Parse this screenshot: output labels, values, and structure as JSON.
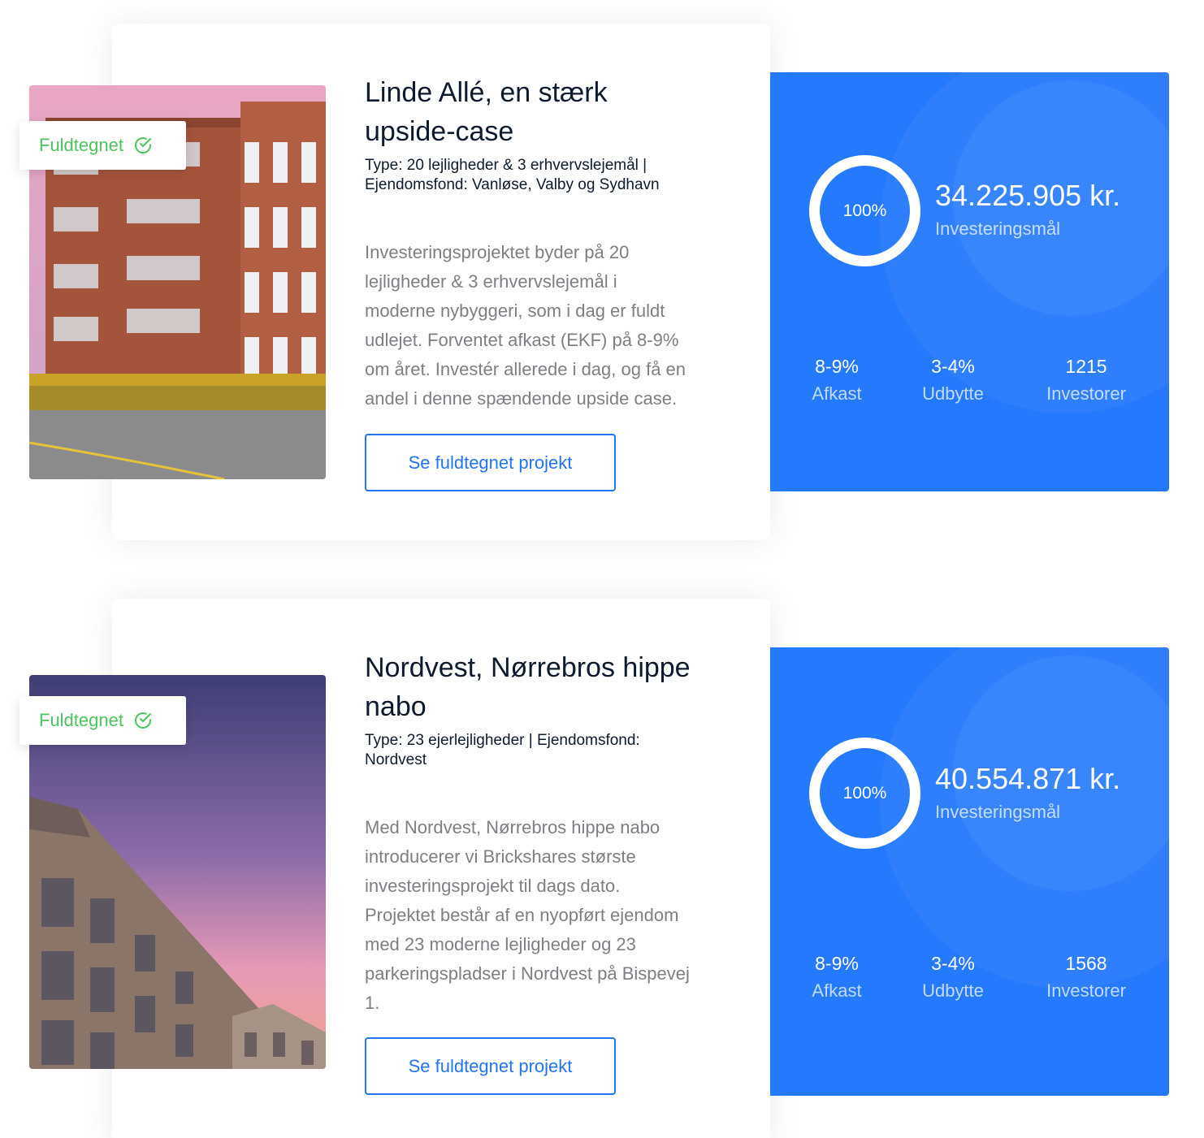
{
  "projects": [
    {
      "badge": "Fuldtegnet",
      "title_lines": [
        "Linde Allé, en stærk",
        "upside-case"
      ],
      "type_lines": [
        "Type: 20 lejligheder & 3 erhvervslejemål |",
        "Ejendomsfond: Vanløse, Valby og Sydhavn"
      ],
      "description_lines": [
        "Investeringsprojektet byder på 20",
        "lejligheder & 3 erhvervslejemål i",
        "moderne nybyggeri, som i dag er fuldt",
        "udlejet. Forventet afkast (EKF) på 8-9%",
        "om året. Investér allerede i dag, og få en",
        "andel i denne spændende upside case."
      ],
      "button": "Se fuldtegnet projekt",
      "progress": "100%",
      "progress_fraction": 1.0,
      "amount": "34.225.905 kr.",
      "amount_label": "Investeringsmål",
      "stats": [
        {
          "value": "8-9%",
          "label": "Afkast"
        },
        {
          "value": "3-4%",
          "label": "Udbytte"
        },
        {
          "value": "1215",
          "label": "Investorer"
        }
      ]
    },
    {
      "badge": "Fuldtegnet",
      "title_lines": [
        "Nordvest, Nørrebros hippe",
        "nabo"
      ],
      "type_lines": [
        "Type: 23 ejerlejligheder | Ejendomsfond:",
        "Nordvest"
      ],
      "description_lines": [
        "Med Nordvest, Nørrebros hippe nabo",
        "introducerer vi Brickshares største",
        "investeringsprojekt til dags dato.",
        "Projektet består af en nyopført ejendom",
        "med 23 moderne lejligheder og 23",
        "parkeringspladser i Nordvest på Bispevej",
        "1."
      ],
      "button": "Se fuldtegnet projekt",
      "progress": "100%",
      "progress_fraction": 1.0,
      "amount": "40.554.871 kr.",
      "amount_label": "Investeringsmål",
      "stats": [
        {
          "value": "8-9%",
          "label": "Afkast"
        },
        {
          "value": "3-4%",
          "label": "Udbytte"
        },
        {
          "value": "1568",
          "label": "Investorer"
        }
      ]
    }
  ],
  "colors": {
    "accent": "#2174f5",
    "panel": "#2479fc",
    "badge_green": "#4cc35d",
    "muted_text": "#7d7f85"
  },
  "icons": [
    "check-circle-icon"
  ]
}
